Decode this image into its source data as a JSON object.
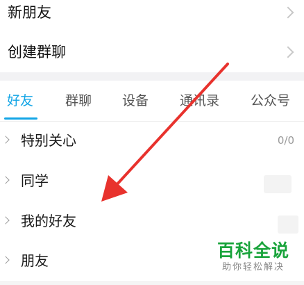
{
  "menu": {
    "new_friends": "新朋友",
    "create_group_chat": "创建群聊"
  },
  "tabs": [
    {
      "label": "好友",
      "active": true
    },
    {
      "label": "群聊",
      "active": false
    },
    {
      "label": "设备",
      "active": false
    },
    {
      "label": "通讯录",
      "active": false
    },
    {
      "label": "公众号",
      "active": false
    }
  ],
  "groups": [
    {
      "name": "特别关心",
      "count": "0/0"
    },
    {
      "name": "同学",
      "count": ""
    },
    {
      "name": "我的好友",
      "count": ""
    },
    {
      "name": "朋友",
      "count": ""
    }
  ],
  "watermark": {
    "title": "百科全说",
    "subtitle": "助你轻松解决"
  },
  "colors": {
    "accent": "#12a5e6",
    "annotation_arrow": "#e8322d",
    "watermark_green": "#1aa43c"
  },
  "icons": {
    "row_chevron": "chevron-right-icon",
    "group_toggle": "caret-right-icon"
  }
}
